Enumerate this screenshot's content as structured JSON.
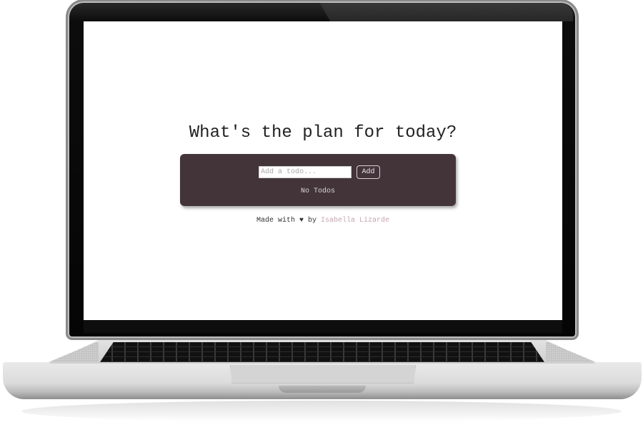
{
  "app": {
    "title": "What's the plan for today?",
    "todo_input": {
      "placeholder": "Add a todo...",
      "value": ""
    },
    "add_button_label": "Add",
    "empty_message": "No Todos",
    "footer": {
      "prefix": "Made with",
      "heart": "♥",
      "by": "by",
      "author": "Isabella Lizarde"
    }
  },
  "colors": {
    "card_background": "#43343a",
    "author_link": "#c4a5ad",
    "heading": "#222222"
  }
}
